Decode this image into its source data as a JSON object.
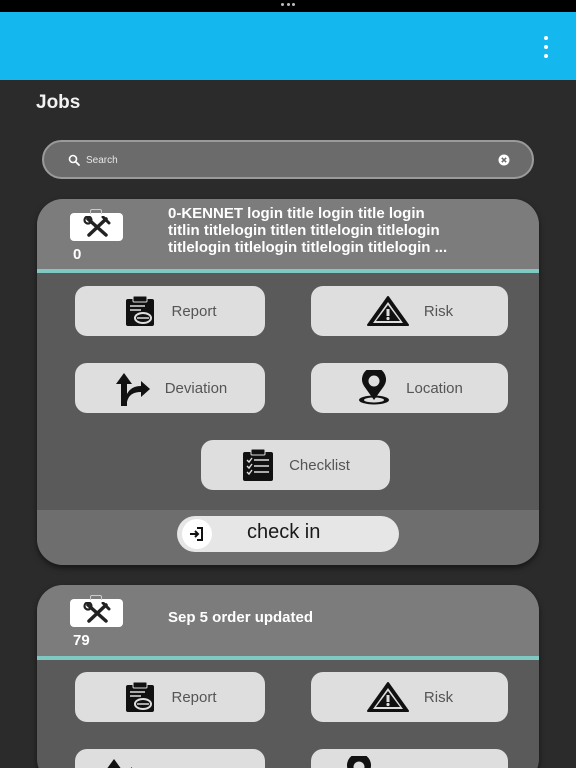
{
  "app": {
    "title": "Jobs"
  },
  "search": {
    "placeholder": "Search",
    "value": ""
  },
  "jobs": [
    {
      "count": "0",
      "title": "0-KENNET login title login title login\ntitlin titlelogin titlen titlelogin titlelogin\ntitlelogin titlelogin titlelogin titlelogin ...",
      "actions": {
        "report": "Report",
        "risk": "Risk",
        "deviation": "Deviation",
        "location": "Location",
        "checklist": "Checklist"
      },
      "checkin_label": "check in"
    },
    {
      "count": "79",
      "title": "Sep 5 order updated",
      "actions": {
        "report": "Report",
        "risk": "Risk"
      }
    }
  ],
  "icons": [
    "menu-icon",
    "search-icon",
    "clear-icon",
    "toolbox-icon",
    "report-icon",
    "warning-icon",
    "deviation-icon",
    "location-pin-icon",
    "checklist-icon",
    "login-icon"
  ],
  "colors": {
    "app_bar": "#14b8ee",
    "background": "#2b2b2b",
    "card": "#5a5a5a",
    "card_header": "#7c7c7c",
    "divider": "#7fc9c2",
    "button": "#dedede"
  }
}
